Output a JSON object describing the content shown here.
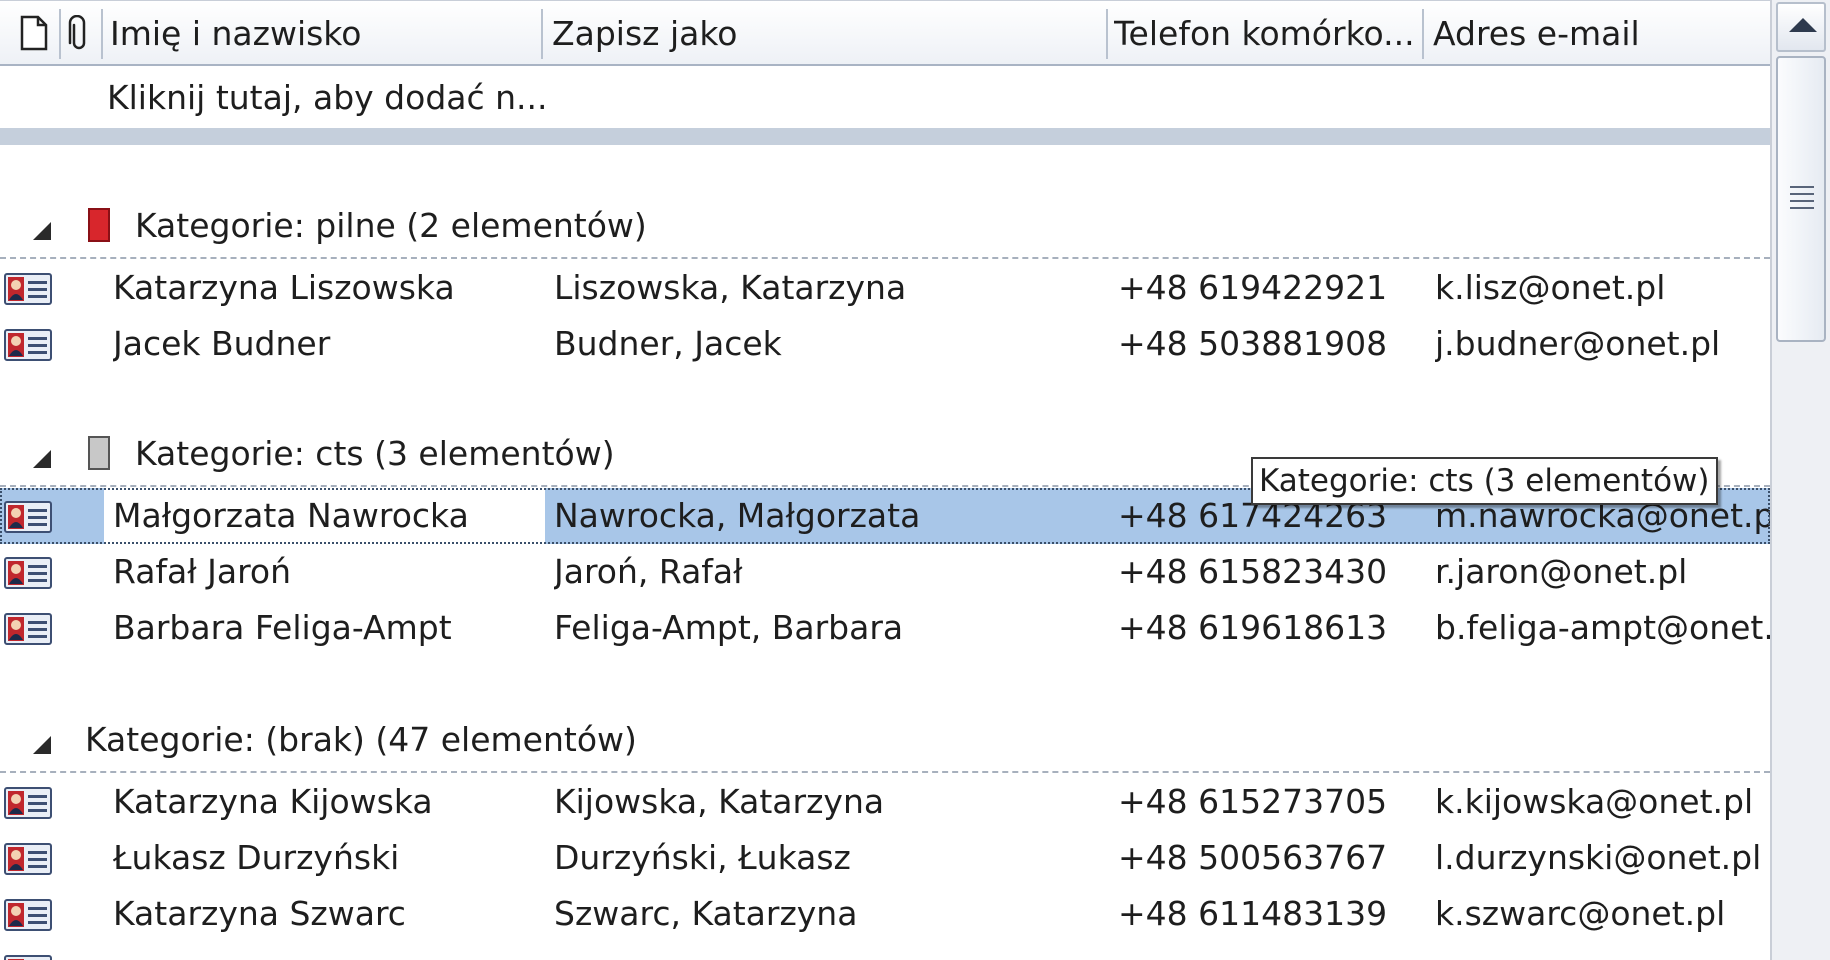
{
  "header": {
    "icon_columns": [
      "item-type-icon",
      "attachment-icon"
    ],
    "columns": [
      "Imię i nazwisko",
      "Zapisz jako",
      "Telefon komórko...",
      "Adres e-mail"
    ]
  },
  "new_item": {
    "placeholder": "Kliknij tutaj, aby dodać n..."
  },
  "groups": [
    {
      "label": "Kategorie: pilne (2 elementów)",
      "color": "#d8262c",
      "rows": [
        {
          "name": "Katarzyna Liszowska",
          "file_as": "Liszowska, Katarzyna",
          "mobile": "+48 619422921",
          "email": "k.lisz@onet.pl"
        },
        {
          "name": "Jacek Budner",
          "file_as": "Budner, Jacek",
          "mobile": "+48 503881908",
          "email": "j.budner@onet.pl"
        }
      ]
    },
    {
      "label": "Kategorie: cts (3 elementów)",
      "color": "#c8c8c8",
      "rows": [
        {
          "name": "Małgorzata Nawrocka",
          "file_as": "Nawrocka, Małgorzata",
          "mobile": "+48 617424263",
          "email": "m.nawrocka@onet.pl"
        },
        {
          "name": "Rafał Jaroń",
          "file_as": "Jaroń, Rafał",
          "mobile": "+48 615823430",
          "email": "r.jaron@onet.pl"
        },
        {
          "name": "Barbara Feliga-Ampt",
          "file_as": "Feliga-Ampt, Barbara",
          "mobile": "+48 619618613",
          "email": "b.feliga-ampt@onet."
        }
      ]
    },
    {
      "label": "Kategorie: (brak) (47 elementów)",
      "rows": [
        {
          "name": "Katarzyna Kijowska",
          "file_as": "Kijowska, Katarzyna",
          "mobile": "+48 615273705",
          "email": "k.kijowska@onet.pl"
        },
        {
          "name": "Łukasz Durzyński",
          "file_as": "Durzyński, Łukasz",
          "mobile": "+48 500563767",
          "email": "l.durzynski@onet.pl"
        },
        {
          "name": "Katarzyna Szwarc",
          "file_as": "Szwarc, Katarzyna",
          "mobile": "+48 611483139",
          "email": "k.szwarc@onet.pl"
        }
      ]
    }
  ],
  "selected_row": "Małgorzata Nawrocka",
  "tooltip": "Kategorie: cts (3 elementów)",
  "icons": {
    "contact": "contact-card-icon",
    "collapse": "collapse-triangle-icon",
    "scroll_up": "scroll-up-arrow-icon",
    "grip": "scroll-grip-icon"
  }
}
